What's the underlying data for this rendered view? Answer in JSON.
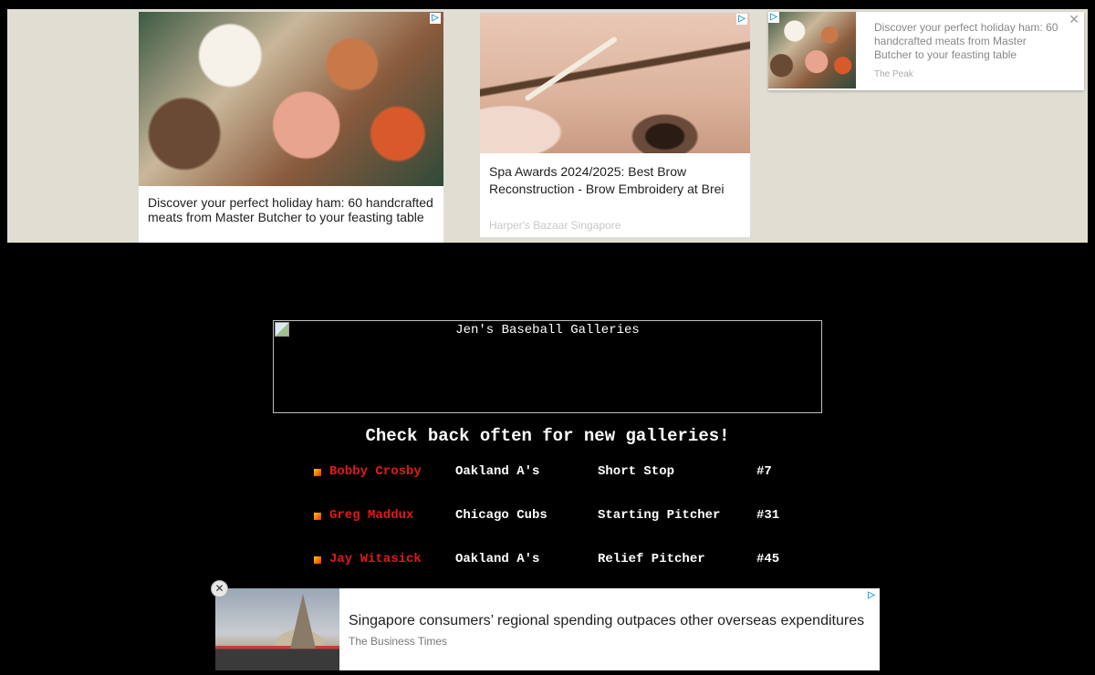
{
  "top_ads": {
    "ad1": {
      "title": "Discover your perfect holiday ham: 60 handcrafted meats from Master Butcher to your feasting table"
    },
    "ad2": {
      "title": "Spa Awards 2024/2025: Best Brow Reconstruction - Brow Embroidery at Brei",
      "source": "Harper's Bazaar Singapore"
    },
    "ad3": {
      "title": "Discover your perfect holiday ham: 60 handcrafted meats from Master Butcher to your feasting table",
      "source": "The Peak",
      "close_glyph": "✕"
    },
    "adchoices_glyph": "▷"
  },
  "banner": {
    "alt_text": "Jen's Baseball Galleries"
  },
  "headline": "Check back often for new galleries!",
  "galleries": [
    {
      "name": "Bobby Crosby",
      "team": "Oakland A's",
      "position": "Short Stop",
      "number": "#7"
    },
    {
      "name": "Greg Maddux",
      "team": "Chicago Cubs",
      "position": "Starting Pitcher",
      "number": "#31"
    },
    {
      "name": "Jay Witasick",
      "team": "Oakland A's",
      "position": "Relief Pitcher",
      "number": "#45"
    }
  ],
  "bottom_ad": {
    "title": "Singapore consumers’ regional spending outpaces other overseas expenditures",
    "source": "The Business Times",
    "close_glyph": "✕"
  },
  "colors": {
    "page_bg": "#000000",
    "ad_band_bg": "#e0ddd3",
    "player_link": "#e01a1a",
    "adchoices": "#2aa4e0"
  },
  "icons": [
    "adchoices-icon",
    "close-icon",
    "bullet-icon",
    "broken-image-icon"
  ]
}
